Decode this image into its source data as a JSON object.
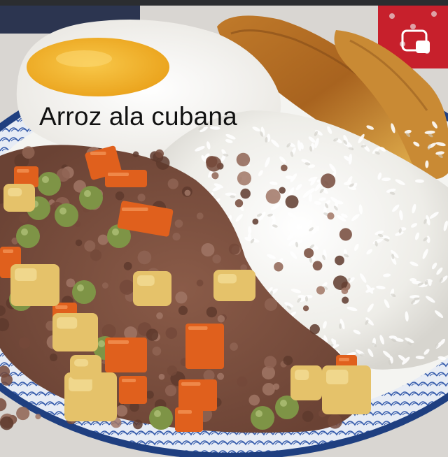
{
  "caption": "Arroz ala cubana",
  "icons": {
    "pip": "picture-in-picture-icon"
  },
  "colors": {
    "background": "#d9d6d2",
    "plate_rim": "#2f4f8f",
    "rice": "#f2f1ec",
    "egg_yolk": "#f3b224",
    "plantain": "#d89b3c",
    "carrot": "#e2621f",
    "beef": "#7a5040",
    "pea": "#8aa052",
    "potato": "#e6c56e"
  }
}
